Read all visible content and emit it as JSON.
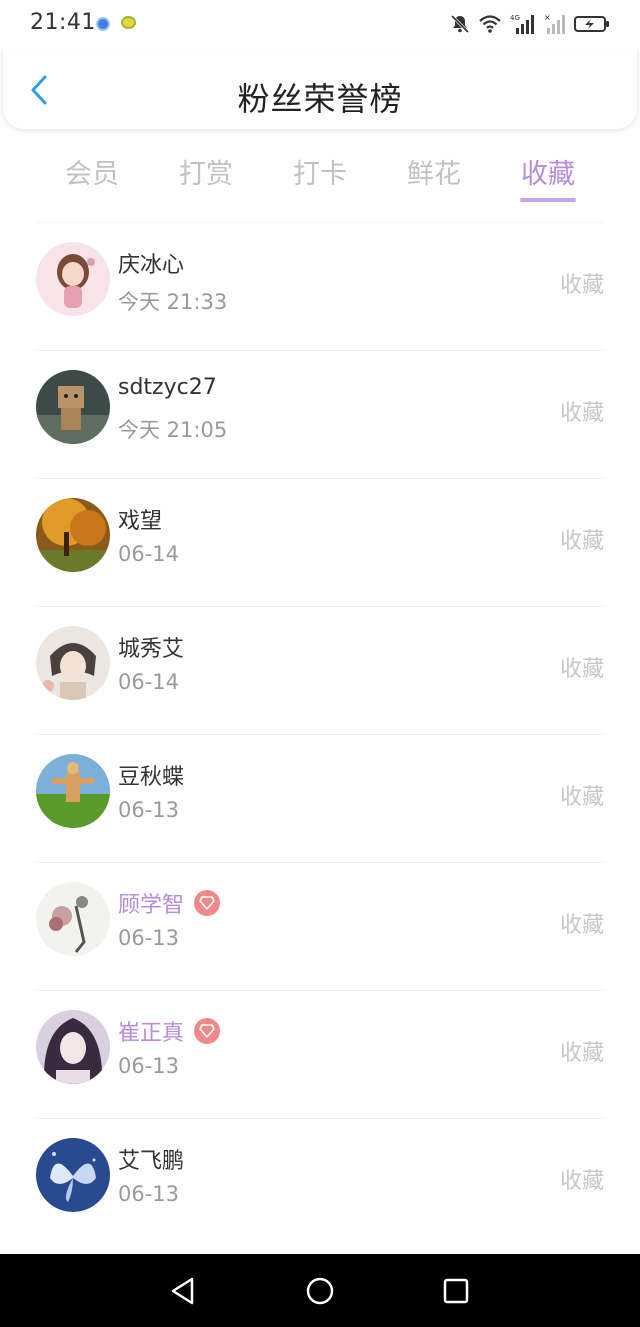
{
  "status_bar": {
    "time": "21:41",
    "icons": [
      "app-icon-blue",
      "app-icon-yellow",
      "mute-bell-icon",
      "wifi-icon",
      "signal-4g-icon",
      "signal-nosim-icon",
      "battery-charging-icon"
    ]
  },
  "header": {
    "title": "粉丝荣誉榜",
    "back_icon": "chevron-left-icon",
    "accent": "#2aa0e8"
  },
  "tabs": [
    {
      "label": "会员",
      "active": false
    },
    {
      "label": "打赏",
      "active": false
    },
    {
      "label": "打卡",
      "active": false
    },
    {
      "label": "鲜花",
      "active": false
    },
    {
      "label": "收藏",
      "active": true
    }
  ],
  "colors": {
    "active_tab": "#b98be0",
    "vip_name": "#b98be0",
    "gem_badge": "#f08a8a",
    "muted_text": "#9a9a9a",
    "action_text": "#c8c8c8"
  },
  "fans": [
    {
      "name": "庆冰心",
      "time": "今天 21:33",
      "action": "收藏",
      "vip": false,
      "avatar": "avatar-cartoon-girl"
    },
    {
      "name": "sdtzyc27",
      "time": "今天 21:05",
      "action": "收藏",
      "vip": false,
      "avatar": "avatar-box-robot"
    },
    {
      "name": "戏望",
      "time": "06-14",
      "action": "收藏",
      "vip": false,
      "avatar": "avatar-autumn-tree"
    },
    {
      "name": "城秀艾",
      "time": "06-14",
      "action": "收藏",
      "vip": false,
      "avatar": "avatar-anime-boy"
    },
    {
      "name": "豆秋蝶",
      "time": "06-13",
      "action": "收藏",
      "vip": false,
      "avatar": "avatar-figure-field"
    },
    {
      "name": "顾学智",
      "time": "06-13",
      "action": "收藏",
      "vip": true,
      "avatar": "avatar-sketch-flowers"
    },
    {
      "name": "崔正真",
      "time": "06-13",
      "action": "收藏",
      "vip": true,
      "avatar": "avatar-anime-girl"
    },
    {
      "name": "艾飞鹏",
      "time": "06-13",
      "action": "收藏",
      "vip": false,
      "avatar": "avatar-butterfly"
    }
  ],
  "nav_bar": {
    "buttons": [
      "back-triangle-icon",
      "home-circle-icon",
      "recents-square-icon"
    ]
  }
}
